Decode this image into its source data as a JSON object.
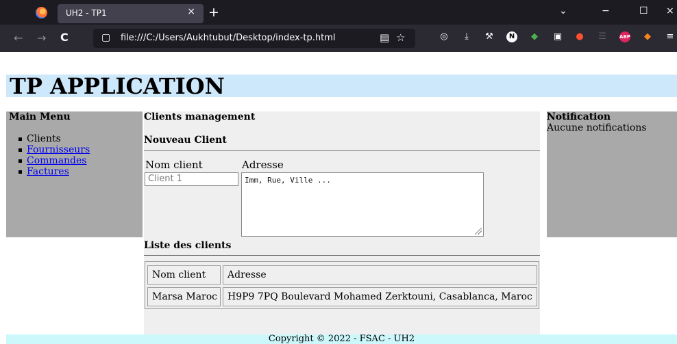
{
  "browser": {
    "tab_title": "UH2 - TP1",
    "tab_close": "×",
    "new_tab": "+",
    "window_controls": {
      "list_tabs": "⌄",
      "minimize": "−",
      "maximize": "☐",
      "close": "×"
    },
    "nav": {
      "back": "←",
      "forward": "→",
      "reload": "C"
    },
    "url": "file:///C:/Users/Aukhtubut/Desktop/index-tp.html",
    "toolbar_icons": [
      "reader-mode-icon",
      "bookmark-star-icon",
      "pocket-icon",
      "download-icon",
      "wrench-icon",
      "notion-icon",
      "evernote-icon",
      "clipboard-icon",
      "extension-icon",
      "sidebar-icon",
      "adblock-icon",
      "fox-icon",
      "menu-icon"
    ]
  },
  "header": {
    "title": "TP APPLICATION"
  },
  "sidebar": {
    "title": "Main Menu",
    "items": [
      {
        "label": "Clients",
        "link": false
      },
      {
        "label": "Fournisseurs",
        "link": true
      },
      {
        "label": "Commandes",
        "link": true
      },
      {
        "label": "Factures",
        "link": true
      }
    ]
  },
  "main": {
    "title": "Clients management",
    "form": {
      "title": "Nouveau Client",
      "name_label": "Nom client",
      "address_label": "Adresse",
      "name_placeholder": "Client 1",
      "address_value": "Imm, Rue, Ville ..."
    },
    "list": {
      "title": "Liste des clients",
      "headers": [
        "Nom client",
        "Adresse"
      ],
      "rows": [
        [
          "Marsa Maroc",
          "H9P9 7PQ Boulevard Mohamed Zerktouni, Casablanca, Maroc"
        ]
      ]
    }
  },
  "notification": {
    "title": "Notification",
    "text": "Aucune notifications"
  },
  "footer": {
    "text": "Copyright © 2022 - FSAC - UH2"
  },
  "colors": {
    "header_bg": "#cde8fb",
    "sidebar_bg": "#a9a9a9",
    "main_bg": "#efefef",
    "footer_bg": "#ccf7fb",
    "link": "#0000ee"
  }
}
